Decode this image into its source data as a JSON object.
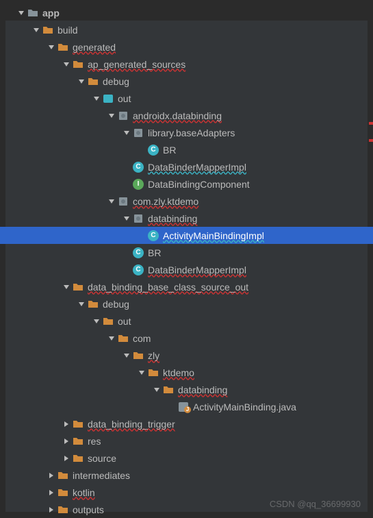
{
  "watermark": "CSDN @qq_36699930",
  "tree": {
    "app": "app",
    "build": "build",
    "generated": "generated",
    "ap_generated_sources": "ap_generated_sources",
    "debug1": "debug",
    "out1": "out",
    "androidx_databinding": "androidx.databinding",
    "library_baseAdapters": "library.baseAdapters",
    "br1": "BR",
    "databindermapperimpl1": "DataBinderMapperImpl",
    "databindingcomponent": "DataBindingComponent",
    "com_zly_ktdemo": "com.zly.ktdemo",
    "databinding1": "databinding",
    "activitymainbindingimpl": "ActivityMainBindingImpl",
    "br2": "BR",
    "databindermapperimpl2": "DataBinderMapperImpl",
    "data_binding_base": "data_binding_base_class_source_out",
    "debug2": "debug",
    "out2": "out",
    "com": "com",
    "zly": "zly",
    "ktdemo": "ktdemo",
    "databinding2": "databinding",
    "activitymainbinding_java": "ActivityMainBinding.java",
    "data_binding_trigger": "data_binding_trigger",
    "res": "res",
    "source": "source",
    "intermediates": "intermediates",
    "kotlin": "kotlin",
    "outputs": "outputs"
  },
  "icons": {
    "class_letter": "C",
    "interface_letter": "I"
  }
}
